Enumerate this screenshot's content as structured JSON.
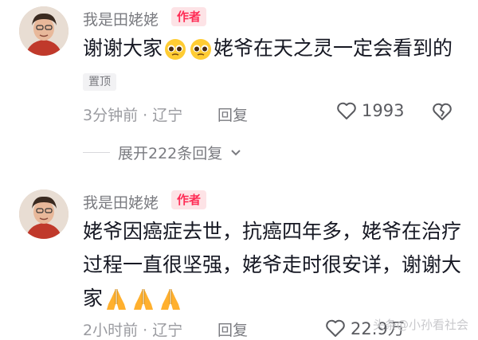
{
  "comments": [
    {
      "username": "我是田姥姥",
      "badge": "作者",
      "text_before": "谢谢大家",
      "text_after": "姥爷在天之灵一定会看到的",
      "pinned_label": "置顶",
      "meta": "3分钟前 · 辽宁",
      "reply_label": "回复",
      "likes": "1993",
      "expand_label": "展开222条回复"
    },
    {
      "username": "我是田姥姥",
      "badge": "作者",
      "text": "姥爷因癌症去世，抗癌四年多，姥爷在治疗过程一直很坚强，姥爷走时很安详，谢谢大家",
      "meta": "2小时前 · 辽宁",
      "reply_label": "回复",
      "likes": "22.9万"
    }
  ],
  "watermark": "头条@小孙看社会",
  "colors": {
    "accent": "#fe2c55",
    "badge_bg": "#fde3e6",
    "muted": "#9a9ba0"
  }
}
